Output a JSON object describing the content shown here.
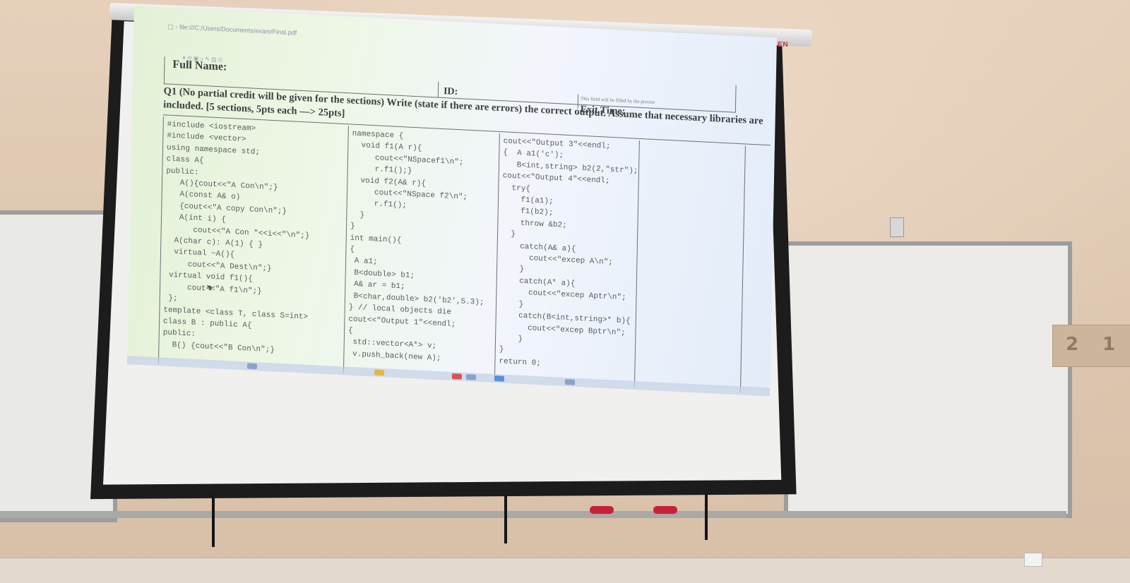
{
  "branding": {
    "screen_brand": "CODEGEN"
  },
  "wall_plate": {
    "left_digit": "2",
    "right_digit": "1"
  },
  "document": {
    "header": {
      "full_name_label": "Full Name:",
      "id_label": "ID:",
      "note": "This field will be filled by the proctor",
      "exit_time_label": "Exit Time:"
    },
    "question": "Q1 (No partial credit will be given for the sections) Write (state if there are errors) the correct output. Assume that necessary libraries are included. [5 sections, 5pts each —> 25pts]",
    "code_columns": [
      "#include <iostream>\n#include <vector>\nusing namespace std;\nclass A{\npublic:\n   A(){cout<<\"A Con\\n\";}\n   A(const A& o)\n   {cout<<\"A copy Con\\n\";}\n   A(int i) {\n      cout<<\"A Con \"<<i<<\"\\n\";}\n  A(char c): A(1) { }\n  virtual ~A(){\n     cout<<\"A Dest\\n\";}\n virtual void f1(){\n     cout<<\"A f1\\n\";}\n };\ntemplate <class T, class S=int>\nclass B : public A{\npublic:\n  B() {cout<<\"B Con\\n\";}",
      "namespace {\n  void f1(A r){\n     cout<<\"NSpacef1\\n\";\n     r.f1();}\n  void f2(A& r){\n     cout<<\"NSpace f2\\n\";\n     r.f1();\n  }\n}\nint main(){\n{\n A a1;\n B<double> b1;\n A& ar = b1;\n B<char,double> b2('b2',5.3);\n} // local objects die\ncout<<\"Output 1\"<<endl;\n{\n std::vector<A*> v;\n v.push_back(new A);",
      "cout<<\"Output 3\"<<endl;\n{  A a1('c');\n   B<int,string> b2(2,\"str\");\ncout<<\"Output 4\"<<endl;\n  try{\n    f1(a1);\n    f1(b2);\n    throw &b2;\n  }\n    catch(A& a){\n      cout<<\"excep A\\n\";\n    }\n    catch(A* a){\n      cout<<\"excep Aptr\\n\";\n    }\n    catch(B<int,string>* b){\n      cout<<\"excep Bptr\\n\";\n    }\n}\nreturn 0;"
    ]
  }
}
